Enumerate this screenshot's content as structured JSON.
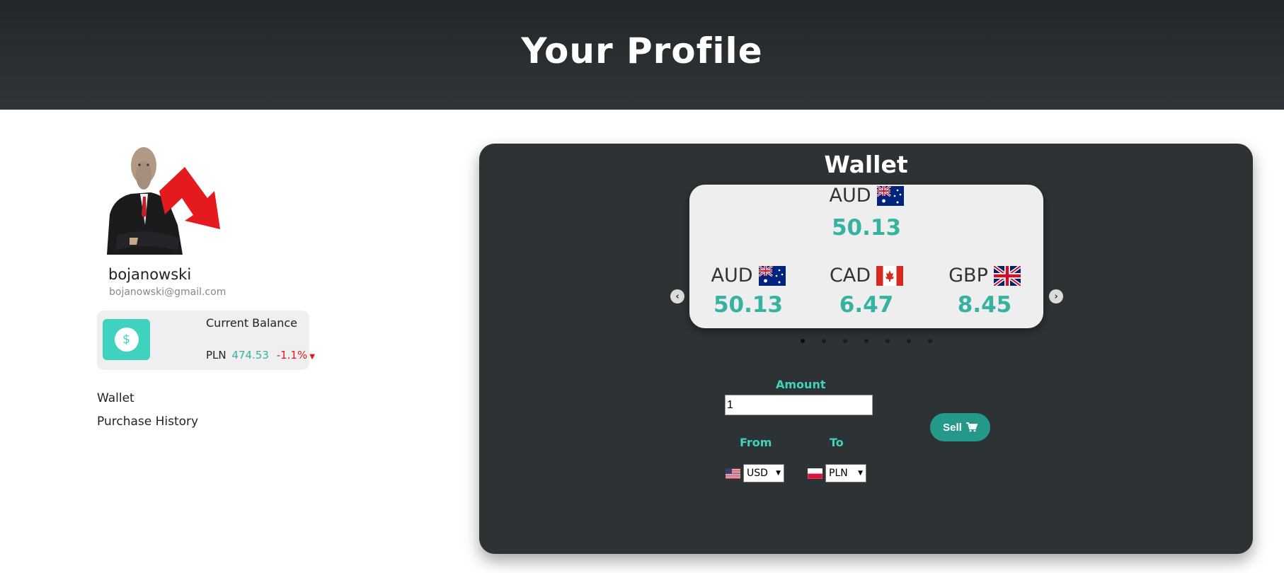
{
  "header": {
    "title": "Your Profile"
  },
  "profile": {
    "username": "bojanowski",
    "email": "bojanowski@gmail.com"
  },
  "balance": {
    "title": "Current Balance",
    "currency": "PLN",
    "amount": "474.53",
    "change": "-1.1%",
    "icon": "dollar-icon",
    "change_color": "#e01818"
  },
  "nav": {
    "wallet": "Wallet",
    "purchase_history": "Purchase History"
  },
  "wallet": {
    "title": "Wallet",
    "featured": {
      "code": "AUD",
      "value": "50.13",
      "flag": "australia-flag-icon"
    },
    "slots": [
      {
        "code": "AUD",
        "value": "50.13",
        "flag": "australia-flag-icon"
      },
      {
        "code": "CAD",
        "value": "6.47",
        "flag": "canada-flag-icon"
      },
      {
        "code": "GBP",
        "value": "8.45",
        "flag": "uk-flag-icon"
      }
    ],
    "dot_count": 7,
    "form": {
      "amount_label": "Amount",
      "amount_value": "1",
      "from_label": "From",
      "to_label": "To",
      "from_value": "USD",
      "to_value": "PLN",
      "sell_label": "Sell"
    }
  },
  "colors": {
    "accent": "#3fd3bf",
    "value_green": "#35b3a0",
    "sell_button": "#24998a",
    "panel_bg": "#2d3235"
  }
}
